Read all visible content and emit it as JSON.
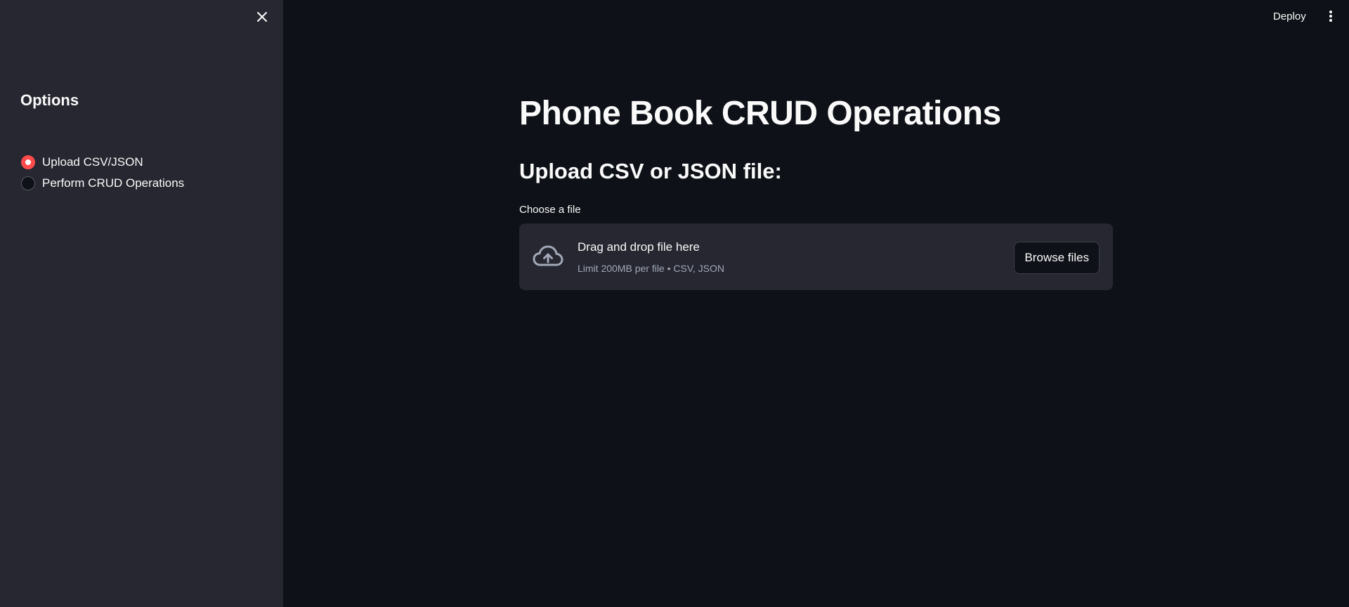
{
  "sidebar": {
    "close_icon": "close-icon",
    "title": "Options",
    "radio_options": [
      {
        "label": "Upload CSV/JSON",
        "selected": true
      },
      {
        "label": "Perform CRUD Operations",
        "selected": false
      }
    ]
  },
  "header": {
    "deploy_label": "Deploy",
    "menu_icon": "more-vertical-icon"
  },
  "main": {
    "title": "Phone Book CRUD Operations",
    "section_heading": "Upload CSV or JSON file:",
    "uploader": {
      "label": "Choose a file",
      "instructions": "Drag and drop file here",
      "limit_text": "Limit 200MB per file • CSV, JSON",
      "browse_label": "Browse files",
      "icon": "cloud-upload-icon"
    }
  },
  "colors": {
    "background": "#0e1117",
    "sidebar_background": "#262730",
    "accent": "#ff4b4b",
    "text": "#fafafa",
    "muted_text": "#a3a8b8"
  }
}
